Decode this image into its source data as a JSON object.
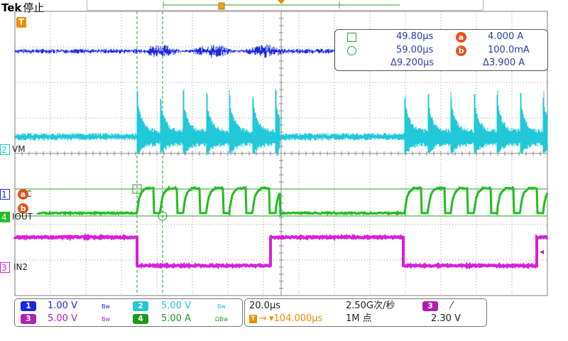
{
  "header": {
    "brand": "Tek",
    "status": "停止"
  },
  "channels": [
    {
      "id": "1",
      "label": "",
      "color": "#1a2adb"
    },
    {
      "id": "2",
      "label": "VM",
      "color": "#20c8d8"
    },
    {
      "id": "4",
      "label": "IOUT",
      "color": "#1fbe1f"
    },
    {
      "id": "3",
      "label": "IN2",
      "color": "#d81fd8"
    }
  ],
  "ch1_suffix": "C",
  "trigger_marker": "T",
  "cursor_readout": {
    "square_time": "49.80μs",
    "circle_time": "59.00μs",
    "delta_time": "Δ9.200μs",
    "a_label": "a",
    "a_value": "4.000 A",
    "b_label": "b",
    "b_value": "100.0mA",
    "delta_value": "Δ3.900 A"
  },
  "channel_settings": {
    "ch1": {
      "num": "1",
      "scale": "1.00 V",
      "bw": "Bw"
    },
    "ch2": {
      "num": "2",
      "scale": "5.00 V",
      "bw": "Bw"
    },
    "ch3": {
      "num": "3",
      "scale": "5.00 V",
      "bw": "Bw"
    },
    "ch4": {
      "num": "4",
      "scale": "5.00 A",
      "bw": "ΩBw"
    }
  },
  "timebase": {
    "scale": "20.0μs",
    "sample_rate": "2.50G次/秒",
    "trigger_pos": "▾104.000μs",
    "record_length": "1M 点"
  },
  "trigger": {
    "source": "3",
    "slope": "⁄",
    "level": "2.30 V"
  }
}
